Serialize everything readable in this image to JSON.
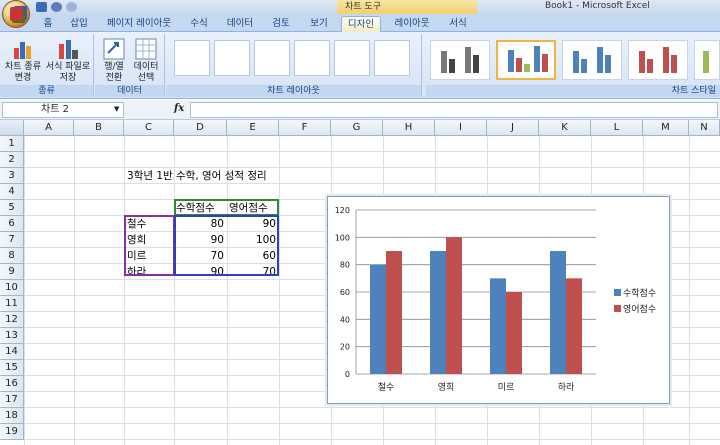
{
  "window": {
    "title": "Book1 - Microsoft Excel",
    "contextual_tools": "차트 도구"
  },
  "tabs": [
    "홈",
    "삽입",
    "페이지 레이아웃",
    "수식",
    "데이터",
    "검토",
    "보기",
    "디자인",
    "레이아웃",
    "서식"
  ],
  "active_tab": "디자인",
  "ribbon": {
    "groups": {
      "type": "종류",
      "data": "데이터",
      "layouts": "차트 레이아웃",
      "styles": "차트 스타일"
    },
    "change_chart_type": "차트 종류\n변경",
    "save_template": "서식 파일로\n저장",
    "switch_row_col": "행/열\n전환",
    "select_data": "데이터\n선택"
  },
  "formula_bar": {
    "name_box": "차트 2",
    "fx": "fx",
    "value": ""
  },
  "columns": [
    "A",
    "B",
    "C",
    "D",
    "E",
    "F",
    "G",
    "H",
    "I",
    "J",
    "K",
    "L",
    "M",
    "N"
  ],
  "rows": [
    "1",
    "2",
    "3",
    "4",
    "5",
    "6",
    "7",
    "8",
    "9",
    "10",
    "11",
    "12",
    "13",
    "14",
    "15",
    "16",
    "17",
    "18",
    "19"
  ],
  "sheet": {
    "title": "3학년 1반 수학, 영어 성적 정리",
    "headers": [
      "수학점수",
      "영어점수"
    ],
    "rows": [
      {
        "name": "철수",
        "math": "80",
        "english": "90"
      },
      {
        "name": "영희",
        "math": "90",
        "english": "100"
      },
      {
        "name": "미르",
        "math": "70",
        "english": "60"
      },
      {
        "name": "하라",
        "math": "90",
        "english": "70"
      }
    ]
  },
  "chart_data": {
    "type": "bar",
    "categories": [
      "철수",
      "영희",
      "미르",
      "하라"
    ],
    "series": [
      {
        "name": "수학점수",
        "values": [
          80,
          90,
          70,
          90
        ],
        "color": "#4f81bd"
      },
      {
        "name": "영어점수",
        "values": [
          90,
          100,
          60,
          70
        ],
        "color": "#c0504d"
      }
    ],
    "yticks": [
      "0",
      "20",
      "40",
      "60",
      "80",
      "100",
      "120"
    ],
    "ylim": [
      0,
      120
    ],
    "grid": true,
    "legend": "right"
  }
}
